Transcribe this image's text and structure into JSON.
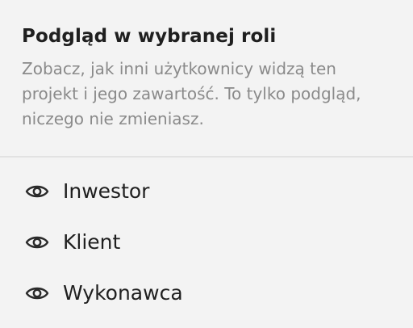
{
  "popover": {
    "title": "Podgląd w wybranej roli",
    "description": "Zobacz, jak inni użytkownicy widzą ten projekt i jego zawartość. To tylko podgląd, niczego nie zmieniasz.",
    "roles": [
      {
        "label": "Inwestor",
        "icon": "eye-icon"
      },
      {
        "label": "Klient",
        "icon": "eye-icon"
      },
      {
        "label": "Wykonawca",
        "icon": "eye-icon"
      }
    ]
  }
}
